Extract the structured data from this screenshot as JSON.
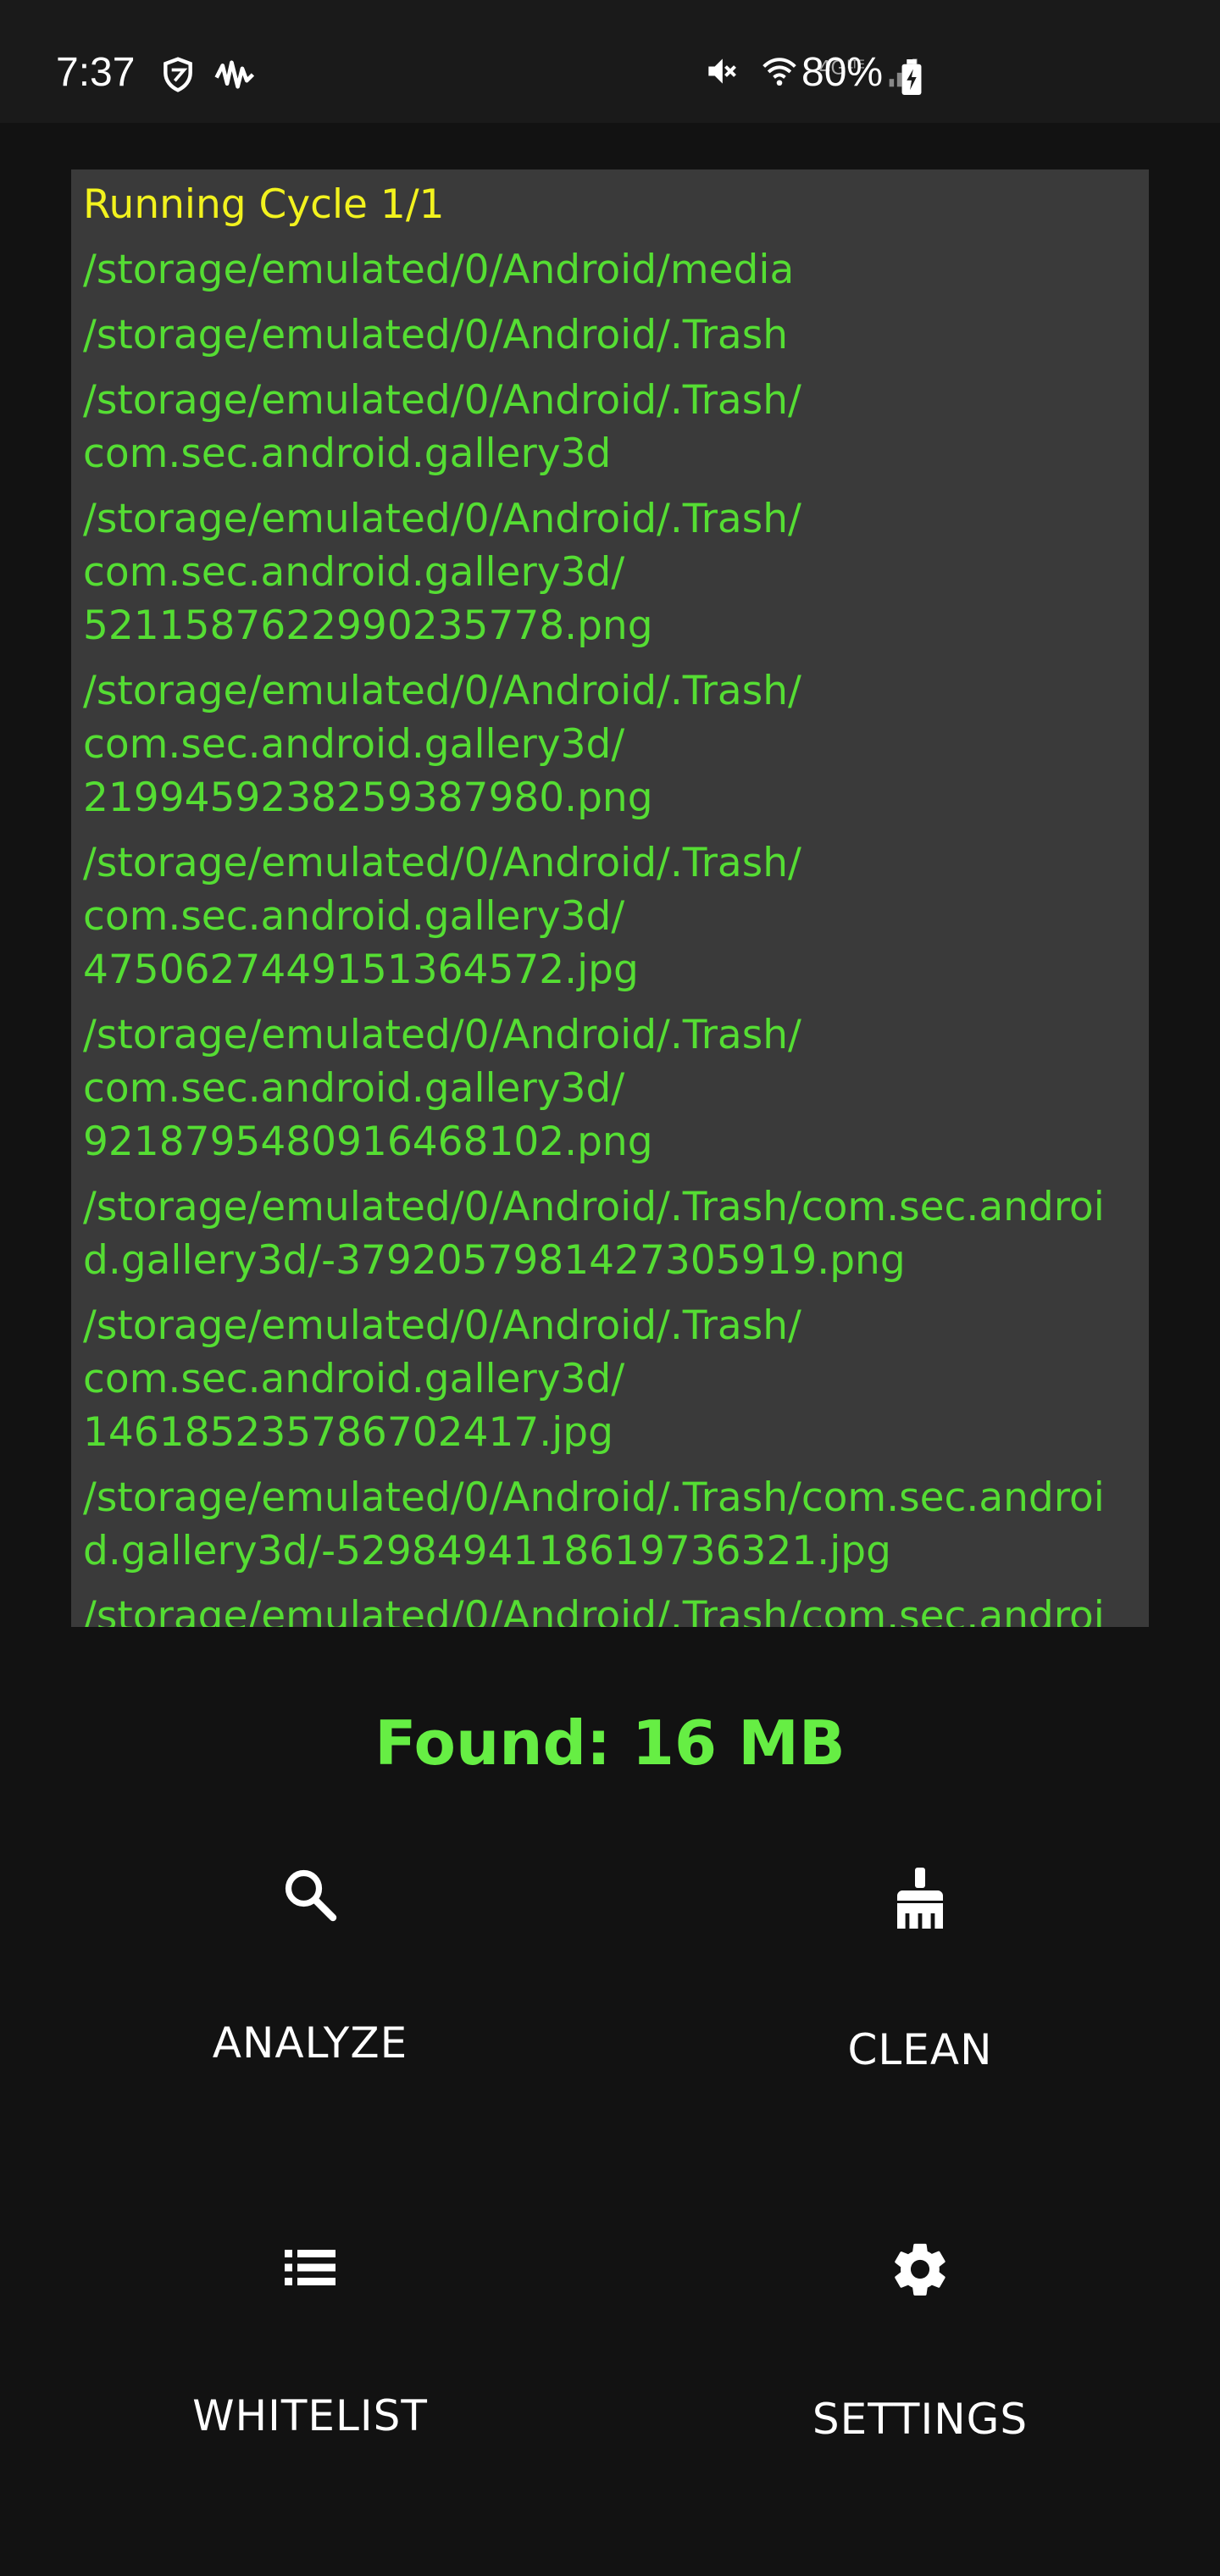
{
  "status_bar": {
    "time": "7:37",
    "battery_percent": "80%",
    "left_icons": [
      "shield-icon",
      "waveform-icon"
    ],
    "right_icons": [
      "mute-icon",
      "wifi-icon",
      "4g-icon",
      "signal-icon",
      "battery-charging-icon"
    ]
  },
  "log": {
    "title": "Running Cycle 1/1",
    "lines": [
      "/storage/emulated/0/Android/media",
      "/storage/emulated/0/Android/.Trash",
      "/storage/emulated/0/Android/.Trash/\ncom.sec.android.gallery3d",
      "/storage/emulated/0/Android/.Trash/\ncom.sec.android.gallery3d/\n5211587622990235778.png",
      "/storage/emulated/0/Android/.Trash/\ncom.sec.android.gallery3d/\n2199459238259387980.png",
      "/storage/emulated/0/Android/.Trash/\ncom.sec.android.gallery3d/\n4750627449151364572.jpg",
      "/storage/emulated/0/Android/.Trash/\ncom.sec.android.gallery3d/\n9218795480916468102.png",
      "/storage/emulated/0/Android/.Trash/com.sec.androi\nd.gallery3d/-3792057981427305919.png",
      "/storage/emulated/0/Android/.Trash/\ncom.sec.android.gallery3d/\n146185235786702417.jpg",
      "/storage/emulated/0/Android/.Trash/com.sec.androi\nd.gallery3d/-5298494118619736321.jpg",
      "/storage/emulated/0/Android/.Trash/com.sec.androi"
    ]
  },
  "found_text": "Found: 16 MB",
  "actions": {
    "analyze": {
      "label": "ANALYZE",
      "icon": "search-icon"
    },
    "clean": {
      "label": "CLEAN",
      "icon": "broom-icon"
    },
    "whitelist": {
      "label": "WHITELIST",
      "icon": "list-icon"
    },
    "settings": {
      "label": "SETTINGS",
      "icon": "gear-icon"
    }
  },
  "colors": {
    "background": "#121212",
    "log_background": "#3a3a3a",
    "log_title": "#f2f21e",
    "log_line": "#55dd33",
    "found": "#66ee44"
  }
}
